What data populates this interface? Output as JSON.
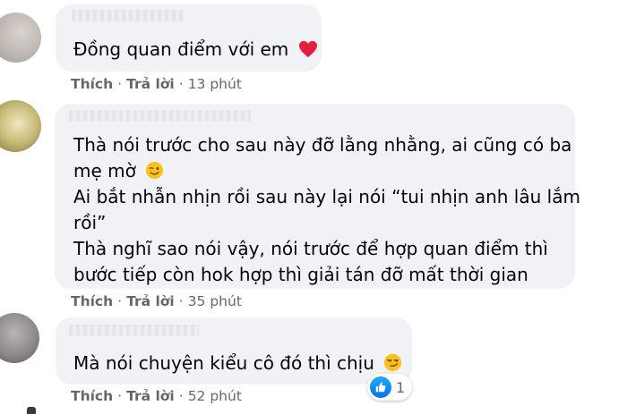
{
  "comments": [
    {
      "text_lines": [
        "Đồng quan điểm với em"
      ],
      "emoji": "heart-emoji",
      "actions": {
        "like": "Thích",
        "reply": "Trả lời"
      },
      "time": "13 phút"
    },
    {
      "text_lines": [
        "Thà nói trước cho sau này đỡ lằng nhằng, ai cũng có ba",
        "mẹ mờ",
        "Ai bắt nhẫn nhịn rồi sau này lại nói “tui nhịn anh lâu lắm",
        "rồi”",
        "Thà nghĩ sao nói vậy, nói trước để hợp quan điểm thì",
        "bước tiếp còn hok hợp thì giải tán đỡ mất thời gian"
      ],
      "emoji": "winking-face-emoji",
      "actions": {
        "like": "Thích",
        "reply": "Trả lời"
      },
      "time": "35 phút"
    },
    {
      "text_lines": [
        "Mà nói chuyện kiểu cô đó thì chịu"
      ],
      "emoji": "smirking-face-emoji",
      "actions": {
        "like": "Thích",
        "reply": "Trả lời"
      },
      "time": "52 phút",
      "reactions": {
        "icon": "like-reaction-icon",
        "count": "1"
      }
    }
  ],
  "separator": "·",
  "colors": {
    "bubble": "#f0f2f5",
    "text": "#050505",
    "meta": "#65676b",
    "like_blue": "#1877f2",
    "heart": "#e41e3f",
    "emoji_yellow": "#fcc21b"
  }
}
